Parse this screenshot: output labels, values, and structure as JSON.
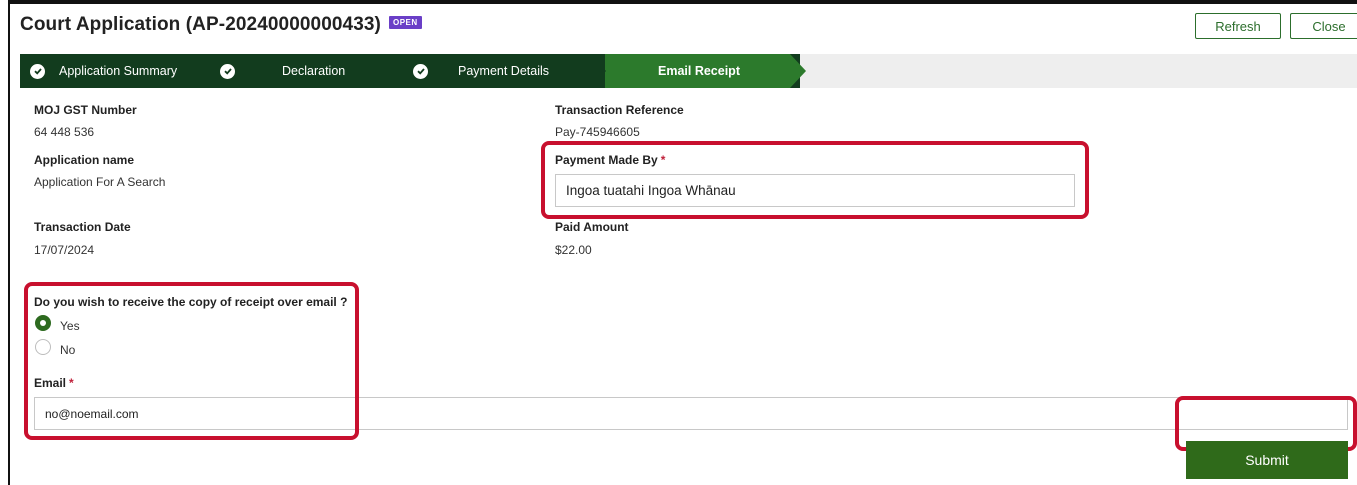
{
  "header": {
    "title": "Court Application (AP-20240000000433)",
    "status_badge": "OPEN",
    "refresh_label": "Refresh",
    "close_label": "Close"
  },
  "steps": [
    {
      "label": "Application Summary",
      "state": "complete"
    },
    {
      "label": "Declaration",
      "state": "complete"
    },
    {
      "label": "Payment Details",
      "state": "complete"
    },
    {
      "label": "Email Receipt",
      "state": "active"
    }
  ],
  "fields": {
    "gst_label": "MOJ GST Number",
    "gst_value": "64 448 536",
    "app_name_label": "Application name",
    "app_name_value": "Application For A Search",
    "txn_date_label": "Transaction Date",
    "txn_date_value": "17/07/2024",
    "txn_ref_label": "Transaction Reference",
    "txn_ref_value": "Pay-745946605",
    "paid_by_label": "Payment Made By",
    "paid_by_value": "Ingoa tuatahi Ingoa Whānau",
    "paid_amount_label": "Paid Amount",
    "paid_amount_value": "$22.00"
  },
  "email_receipt": {
    "question": "Do you wish to receive the copy of receipt over email ?",
    "options": [
      {
        "label": "Yes",
        "selected": true
      },
      {
        "label": "No",
        "selected": false
      }
    ],
    "email_label": "Email",
    "email_value": "no@noemail.com"
  },
  "required_marker": "*",
  "submit_label": "Submit",
  "colors": {
    "accent_green": "#2f6a1a",
    "step_dark": "#123c1e",
    "step_active": "#2c7a2c",
    "highlight_red": "#c8102e",
    "badge_purple": "#6a3fc7"
  }
}
